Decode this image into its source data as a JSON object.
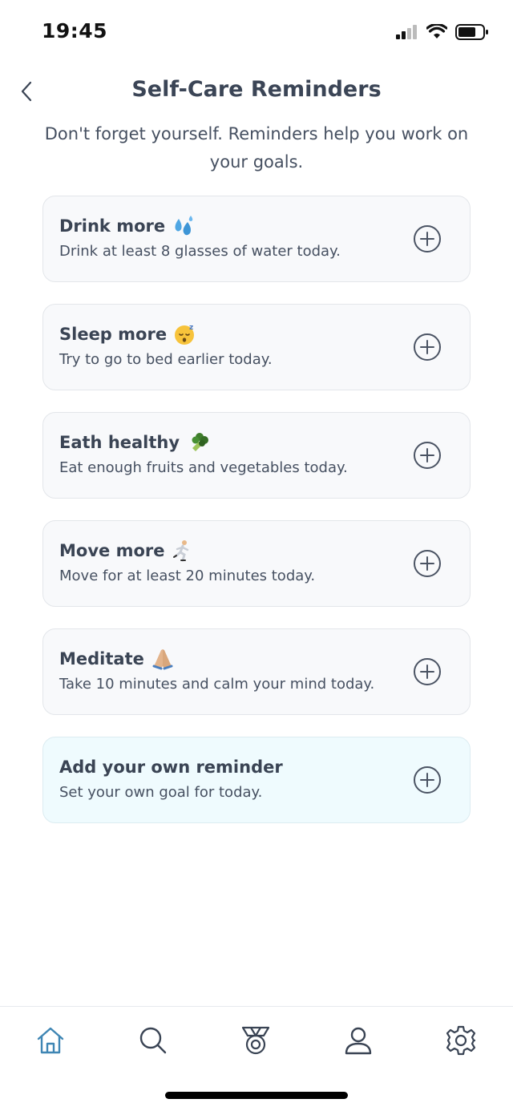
{
  "status_bar": {
    "time": "19:45"
  },
  "header": {
    "title": "Self-Care Reminders"
  },
  "subtitle": "Don't forget yourself. Reminders help you work on your goals.",
  "reminders": [
    {
      "title": "Drink more",
      "description": "Drink at least 8 glasses of water today.",
      "emoji": "sweat-droplets-icon"
    },
    {
      "title": "Sleep more",
      "description": "Try to go to bed earlier today.",
      "emoji": "sleeping-face-icon"
    },
    {
      "title": "Eath healthy",
      "description": "Eat enough fruits and vegetables today.",
      "emoji": "broccoli-icon"
    },
    {
      "title": "Move more",
      "description": "Move for at least 20 minutes today.",
      "emoji": "running-person-icon"
    },
    {
      "title": "Meditate",
      "description": "Take 10 minutes and calm your mind today.",
      "emoji": "folded-hands-icon"
    }
  ],
  "custom_reminder": {
    "title": "Add your own reminder",
    "description": "Set your own goal for today."
  },
  "tabs": [
    "home",
    "search",
    "achievements",
    "profile",
    "settings"
  ],
  "colors": {
    "accent": "#3f86b4",
    "card_bg": "#f8f9fb",
    "custom_bg": "#effbfe",
    "text": "#3a4454"
  }
}
